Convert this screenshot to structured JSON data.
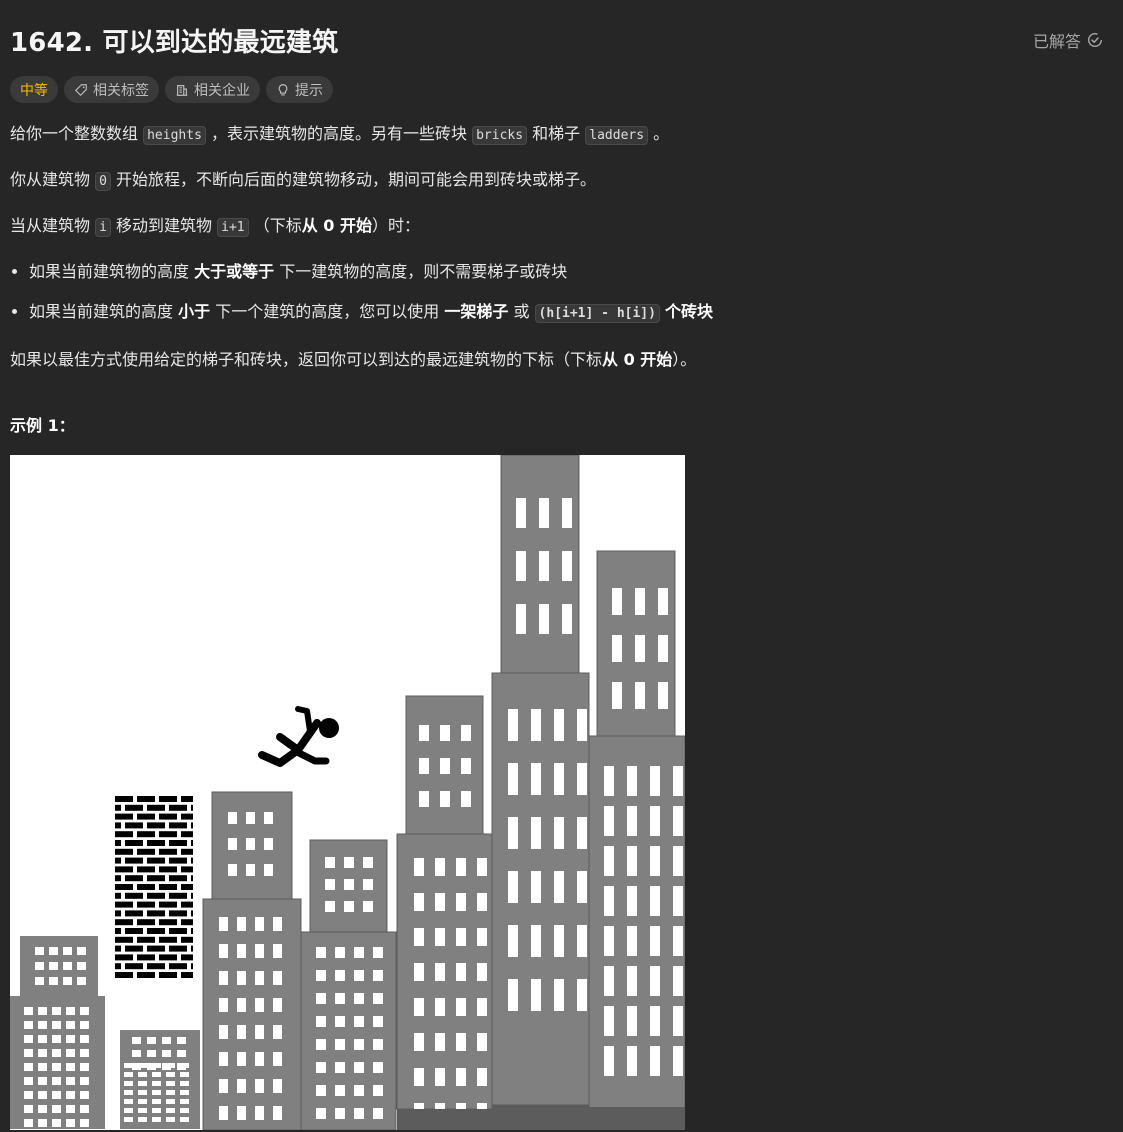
{
  "header": {
    "title": "1642. 可以到达的最远建筑",
    "status": "已解答"
  },
  "tags": {
    "difficulty": "中等",
    "related_tags": "相关标签",
    "related_companies": "相关企业",
    "hints": "提示"
  },
  "description": {
    "p1": {
      "t1": "给你一个整数数组",
      "c1": "heights",
      "t2": "，表示建筑物的高度。另有一些砖块",
      "c2": "bricks",
      "t3": "和梯子",
      "c3": "ladders",
      "t4": "。"
    },
    "p2": {
      "t1": "你从建筑物",
      "c1": "0",
      "t2": "开始旅程，不断向后面的建筑物移动，期间可能会用到砖块或梯子。"
    },
    "p3": {
      "t1": "当从建筑物",
      "c1": "i",
      "t2": "移动到建筑物",
      "c2": "i+1",
      "t3": "（下标",
      "b1": "从 0 开始",
      "t4": "）时："
    },
    "bullets": [
      {
        "t1": "如果当前建筑物的高度",
        "b1": "大于或等于",
        "t2": "下一建筑物的高度，则不需要梯子或砖块"
      },
      {
        "t1": "如果当前建筑的高度",
        "b1": "小于",
        "t2": "下一个建筑的高度，您可以使用",
        "b2": "一架梯子",
        "t3": "或",
        "c1": "(h[i+1] - h[i])",
        "b3": "个砖块"
      }
    ],
    "p4": {
      "t1": "如果以最佳方式使用给定的梯子和砖块，返回你可以到达的最远建筑物的下标（下标",
      "b1": "从 0 开始",
      "t2": "）。"
    }
  },
  "example": {
    "title": "示例 1："
  },
  "colors": {
    "background": "#262626",
    "difficulty_medium": "#ffb800",
    "tag_bg": "#3a3a3a",
    "building_gray": "#808080",
    "bricks_black": "#000000"
  }
}
